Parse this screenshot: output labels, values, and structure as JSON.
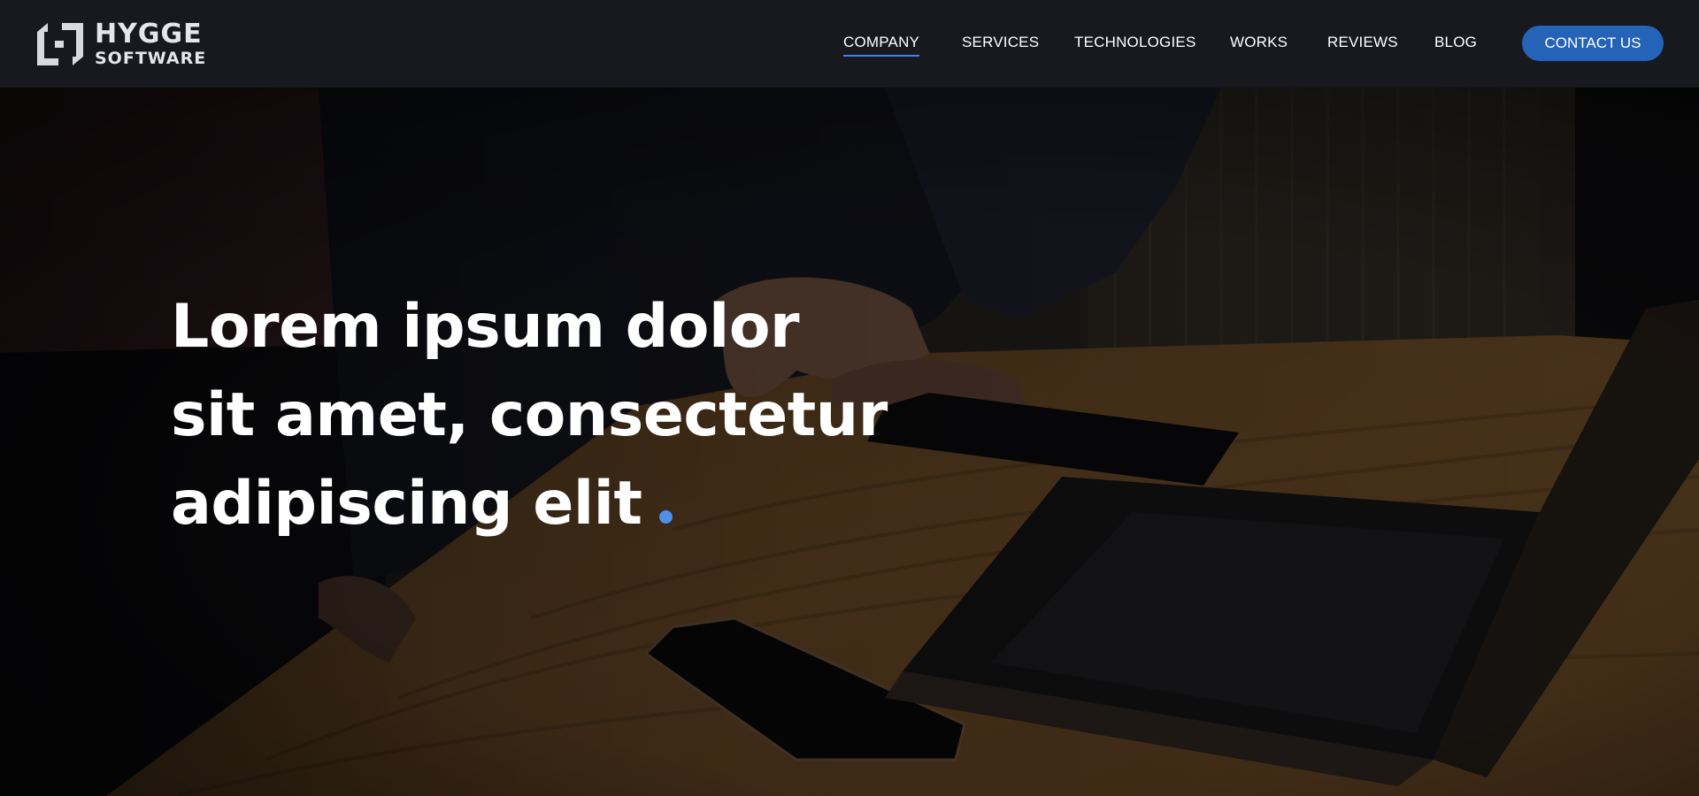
{
  "brand": {
    "name_line1": "HYGGE",
    "name_line2": "SOFTWARE",
    "logo_icon": "hygge-logo-icon"
  },
  "nav": {
    "items": [
      {
        "label": "COMPANY",
        "active": true
      },
      {
        "label": "SERVICES",
        "active": false
      },
      {
        "label": "TECHNOLOGIES",
        "active": false
      },
      {
        "label": "WORKS",
        "active": false
      },
      {
        "label": "REVIEWS",
        "active": false
      },
      {
        "label": "BLOG",
        "active": false
      }
    ],
    "cta_label": "CONTACT US"
  },
  "hero": {
    "headline_lines": [
      "Lorem ipsum dolor",
      "sit amet, consectetur",
      "adipiscing elit"
    ],
    "background_image": "people-at-wooden-desk-with-laptop-and-phones"
  },
  "colors": {
    "header_bg": "#17191f",
    "accent": "#2563b8",
    "dot": "#4f8fe8",
    "active_underline": "#3b82f6"
  }
}
